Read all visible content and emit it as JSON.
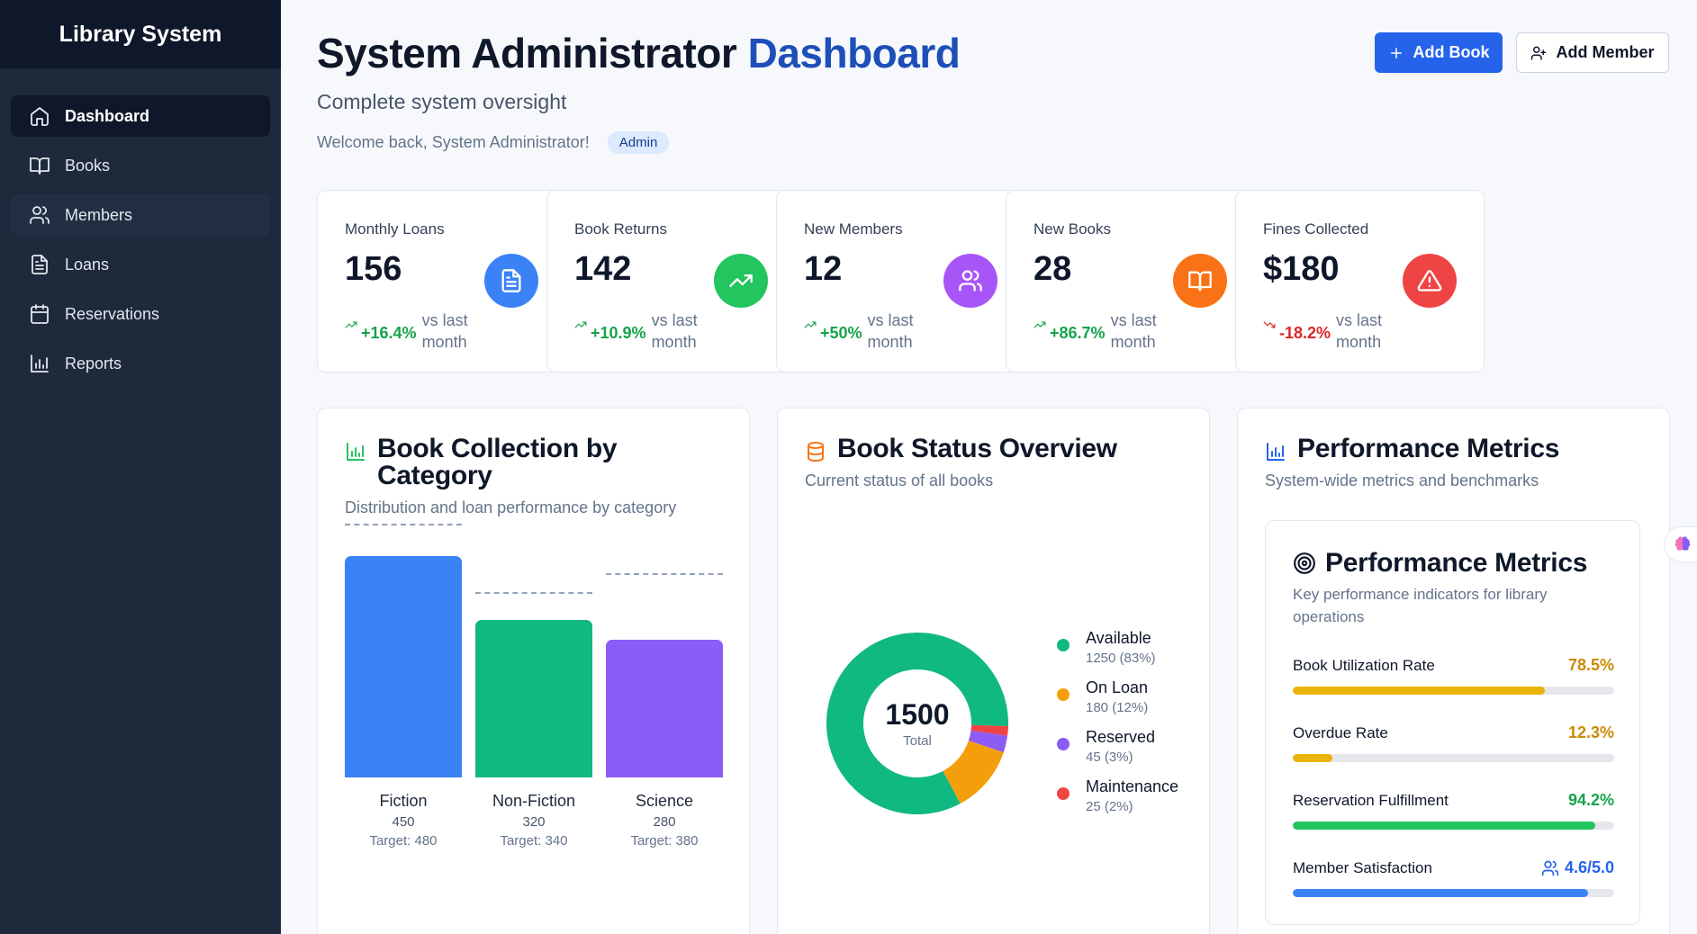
{
  "app": {
    "brand": "Library System"
  },
  "sidebar": {
    "items": [
      {
        "label": "Dashboard",
        "icon": "home-icon"
      },
      {
        "label": "Books",
        "icon": "book-open-icon"
      },
      {
        "label": "Members",
        "icon": "users-icon"
      },
      {
        "label": "Loans",
        "icon": "file-text-icon"
      },
      {
        "label": "Reservations",
        "icon": "calendar-icon"
      },
      {
        "label": "Reports",
        "icon": "bar-chart-icon"
      }
    ],
    "active": "Dashboard"
  },
  "header": {
    "title_main": "System Administrator",
    "title_accent": "Dashboard",
    "subtitle": "Complete system oversight",
    "welcome": "Welcome back, System Administrator!",
    "role_badge": "Admin",
    "add_book_label": "Add Book",
    "add_member_label": "Add Member"
  },
  "stats": [
    {
      "label": "Monthly Loans",
      "value": "156",
      "change": "+16.4%",
      "direction": "up",
      "suffix": "vs last month",
      "icon": "file-text-icon",
      "color": "#3b82f6"
    },
    {
      "label": "Book Returns",
      "value": "142",
      "change": "+10.9%",
      "direction": "up",
      "suffix": "vs last month",
      "icon": "trending-up-icon",
      "color": "#22c55e"
    },
    {
      "label": "New Members",
      "value": "12",
      "change": "+50%",
      "direction": "up",
      "suffix": "vs last month",
      "icon": "users-icon",
      "color": "#a855f7"
    },
    {
      "label": "New Books",
      "value": "28",
      "change": "+86.7%",
      "direction": "up",
      "suffix": "vs last month",
      "icon": "book-open-icon",
      "color": "#f97316"
    },
    {
      "label": "Fines Collected",
      "value": "$180",
      "change": "-18.2%",
      "direction": "down",
      "suffix": "vs last month",
      "icon": "alert-triangle-icon",
      "color": "#ef4444"
    }
  ],
  "panels": {
    "collection": {
      "title": "Book Collection by Category",
      "subtitle": "Distribution and loan performance by category",
      "icon": "bar-chart-icon",
      "icon_color": "#22c55e"
    },
    "status": {
      "title": "Book Status Overview",
      "subtitle": "Current status of all books",
      "icon": "database-icon",
      "icon_color": "#f97316",
      "total": "1500",
      "total_label": "Total"
    },
    "performance": {
      "title": "Performance Metrics",
      "subtitle": "System-wide metrics and benchmarks",
      "icon": "bar-chart-icon",
      "icon_color": "#2563eb",
      "inner_title": "Performance Metrics",
      "inner_icon": "target-icon",
      "inner_subtitle": "Key performance indicators for library operations",
      "metrics": [
        {
          "name": "Book Utilization Rate",
          "value": "78.5%",
          "fraction": 0.785,
          "color": "#eab308",
          "text_color": "#ca8a04"
        },
        {
          "name": "Overdue Rate",
          "value": "12.3%",
          "fraction": 0.123,
          "color": "#eab308",
          "text_color": "#ca8a04"
        },
        {
          "name": "Reservation Fulfillment",
          "value": "94.2%",
          "fraction": 0.942,
          "color": "#22c55e",
          "text_color": "#16a34a"
        },
        {
          "name": "Member Satisfaction",
          "value": "4.6/5.0",
          "fraction": 0.92,
          "color": "#3b82f6",
          "text_color": "#2563eb",
          "icon": "users-icon"
        }
      ]
    }
  },
  "chart_data": [
    {
      "type": "bar",
      "categories": [
        "Fiction",
        "Non-Fiction",
        "Science"
      ],
      "values": [
        450,
        320,
        280
      ],
      "targets": [
        480,
        340,
        380
      ],
      "target_prefix": "Target: ",
      "colors": [
        "#3b82f6",
        "#10b981",
        "#8b5cf6"
      ],
      "ylim": [
        0,
        480
      ]
    },
    {
      "type": "pie",
      "labels": [
        "Available",
        "On Loan",
        "Reserved",
        "Maintenance"
      ],
      "values": [
        1250,
        180,
        45,
        25
      ],
      "percents": [
        "83%",
        "12%",
        "3%",
        "2%"
      ],
      "colors": [
        "#10b981",
        "#f59e0b",
        "#8b5cf6",
        "#ef4444"
      ],
      "donut": true
    }
  ]
}
